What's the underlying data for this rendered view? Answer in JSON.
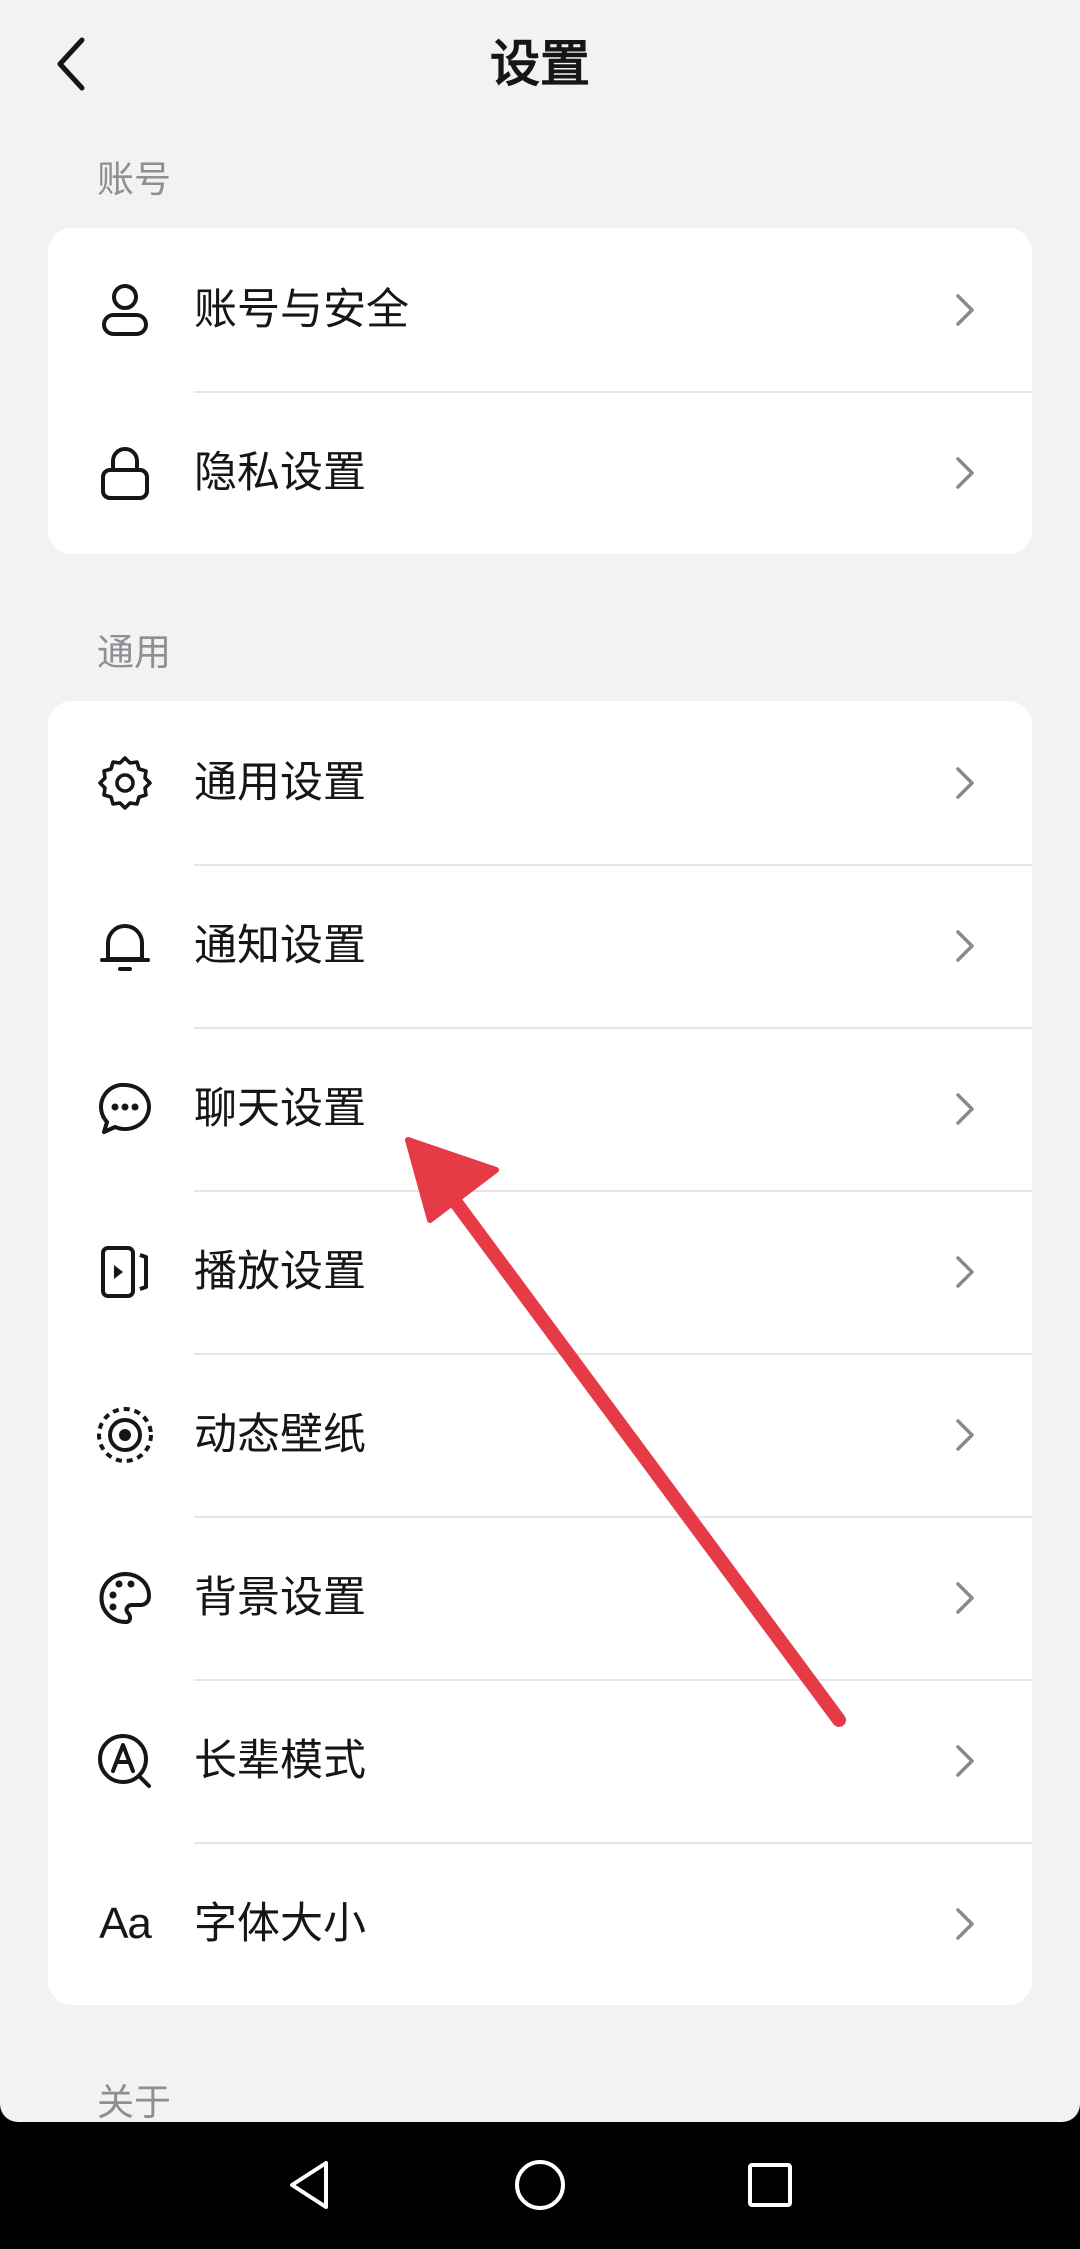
{
  "header": {
    "title": "设置"
  },
  "sections": [
    {
      "label": "账号",
      "items": [
        {
          "label": "账号与安全",
          "icon": "person-icon"
        },
        {
          "label": "隐私设置",
          "icon": "lock-icon"
        }
      ]
    },
    {
      "label": "通用",
      "items": [
        {
          "label": "通用设置",
          "icon": "gear-icon"
        },
        {
          "label": "通知设置",
          "icon": "bell-icon"
        },
        {
          "label": "聊天设置",
          "icon": "chat-bubble-icon"
        },
        {
          "label": "播放设置",
          "icon": "play-screen-icon"
        },
        {
          "label": "动态壁纸",
          "icon": "live-wallpaper-icon"
        },
        {
          "label": "背景设置",
          "icon": "palette-icon"
        },
        {
          "label": "长辈模式",
          "icon": "elder-mode-icon"
        },
        {
          "label": "字体大小",
          "icon": "font-size-icon",
          "glyph": "Aa"
        }
      ]
    },
    {
      "label": "关于"
    }
  ],
  "annotation": {
    "type": "arrow",
    "color": "#e63a46",
    "points_to": "聊天设置"
  },
  "navbar": {
    "buttons": [
      "back-triangle-icon",
      "home-circle-icon",
      "recents-square-icon"
    ]
  },
  "colors": {
    "background": "#f2f2f3",
    "card": "#ffffff",
    "text": "#161616",
    "section_label": "#8e8e93",
    "chevron": "#8a8a8e",
    "divider": "#e5e5e7"
  }
}
